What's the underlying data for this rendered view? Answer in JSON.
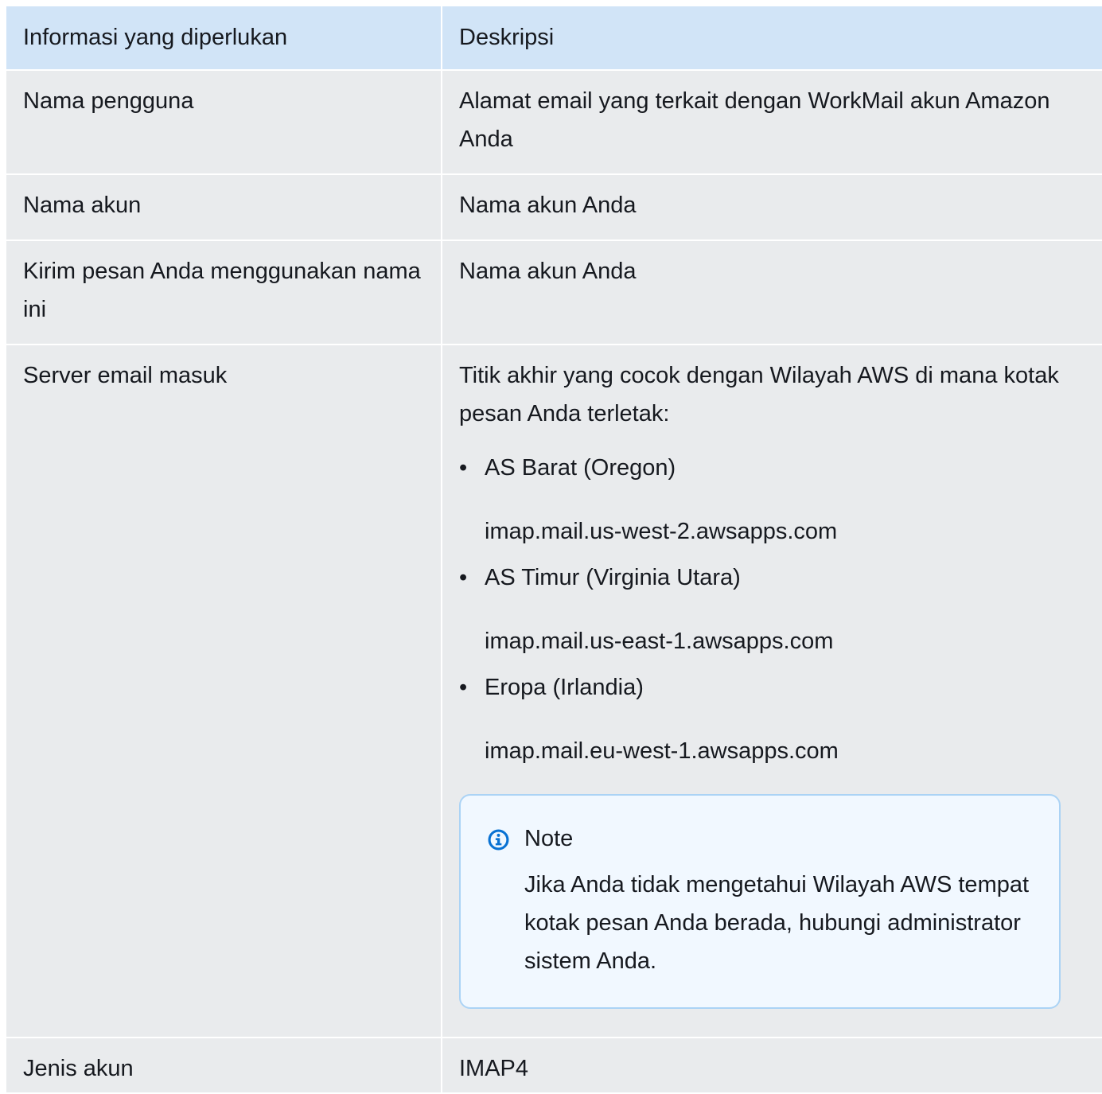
{
  "table": {
    "headers": [
      "Informasi yang diperlukan",
      "Deskripsi"
    ],
    "rows": [
      {
        "label": "Nama pengguna",
        "description": "Alamat email yang terkait dengan WorkMail akun Amazon Anda"
      },
      {
        "label": "Nama akun",
        "description": "Nama akun Anda"
      },
      {
        "label": "Kirim pesan Anda menggunakan nama ini",
        "description": "Nama akun Anda"
      },
      {
        "label": "Server email masuk",
        "description": "Titik akhir yang cocok dengan Wilayah AWS di mana kotak pesan Anda terletak:",
        "bullet": "•",
        "regions": [
          {
            "name": "AS Barat (Oregon)",
            "endpoint": "imap.mail.us-west-2.awsapps.com"
          },
          {
            "name": "AS Timur (Virginia Utara)",
            "endpoint": "imap.mail.us-east-1.awsapps.com"
          },
          {
            "name": "Eropa (Irlandia)",
            "endpoint": "imap.mail.eu-west-1.awsapps.com"
          }
        ],
        "note": {
          "icon": "info-icon",
          "title": "Note",
          "body": "Jika Anda tidak mengetahui Wilayah AWS tempat kotak pesan Anda berada, hubungi administrator sistem Anda."
        }
      },
      {
        "label": "Jenis akun",
        "description": "IMAP4"
      }
    ]
  },
  "colors": {
    "header_bg": "#d1e4f7",
    "row_bg": "#e9ebed",
    "note_bg": "#f1f8ff",
    "note_border": "#abd3f5",
    "info_icon": "#0972d3"
  }
}
